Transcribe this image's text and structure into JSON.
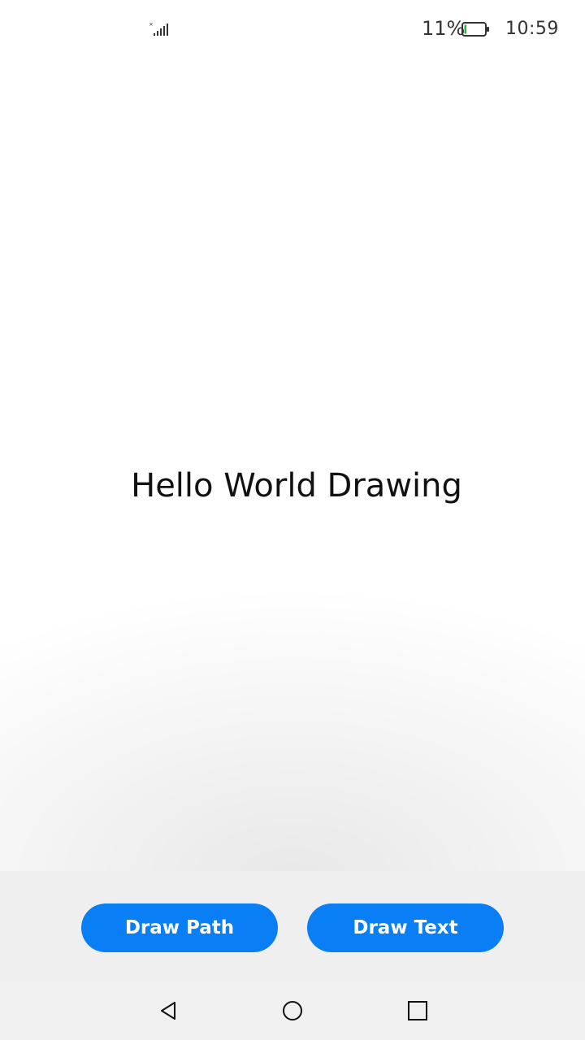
{
  "status_bar": {
    "battery_percent": "11%",
    "time": "10:59",
    "battery_level": 0.11,
    "battery_color": "#3cb043"
  },
  "canvas": {
    "text": "Hello World Drawing"
  },
  "buttons": {
    "draw_path_label": "Draw Path",
    "draw_text_label": "Draw Text",
    "accent_color": "#0a7ff5"
  },
  "nav_bar": {
    "back_icon": "triangle-back-icon",
    "home_icon": "circle-home-icon",
    "recent_icon": "square-recents-icon"
  }
}
